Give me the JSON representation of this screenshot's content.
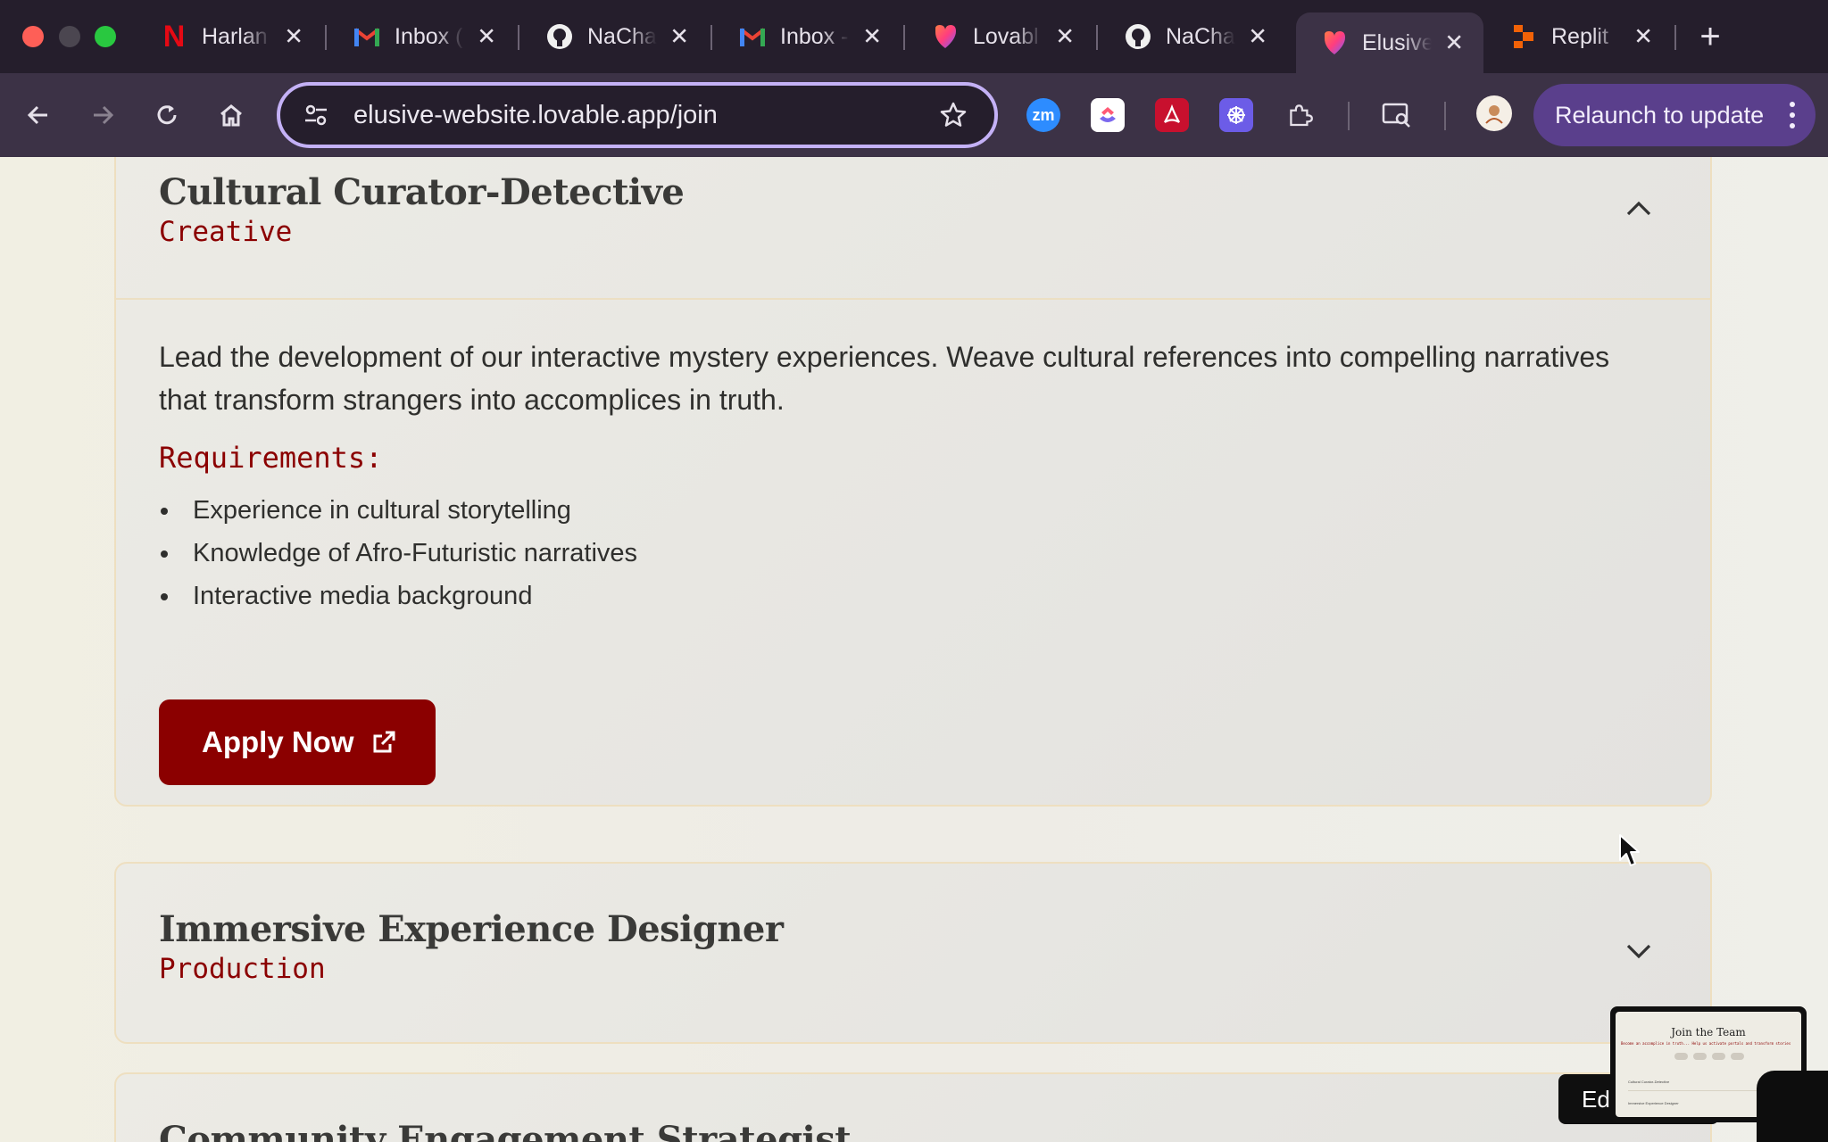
{
  "browser": {
    "tabs": [
      {
        "title": "Harlan",
        "icon": "netflix-icon"
      },
      {
        "title": "Inbox (",
        "icon": "gmail-icon"
      },
      {
        "title": "NaCha",
        "icon": "github-icon"
      },
      {
        "title": "Inbox -",
        "icon": "gmail-icon"
      },
      {
        "title": "Lovabl",
        "icon": "lovable-icon"
      },
      {
        "title": "NaCha",
        "icon": "github-icon"
      },
      {
        "title": "Elusive",
        "icon": "lovable-icon",
        "active": true
      },
      {
        "title": "Replit",
        "icon": "replit-icon"
      }
    ],
    "url": "elusive-website.lovable.app/join",
    "relaunch_label": "Relaunch to update",
    "extensions": [
      "zoom-icon",
      "clickup-icon",
      "acrobat-icon",
      "perplexity-icon",
      "puzzle-icon"
    ],
    "colors": {
      "chrome_dark": "#251e2c",
      "toolbar": "#3c3246",
      "omnibox_border": "#c4b1f6",
      "relaunch_bg": "#5a3f8c"
    }
  },
  "page": {
    "roles": [
      {
        "title": "Cultural Curator-Detective",
        "category": "Creative",
        "expanded": true,
        "description": "Lead the development of our interactive mystery experiences. Weave cultural references into compelling narratives that transform strangers into accomplices in truth.",
        "requirements_heading": "Requirements:",
        "requirements": [
          "Experience in cultural storytelling",
          "Knowledge of Afro-Futuristic narratives",
          "Interactive media background"
        ],
        "apply_label": "Apply Now"
      },
      {
        "title": "Immersive Experience Designer",
        "category": "Production",
        "expanded": false
      },
      {
        "title": "Community Engagement Strategist",
        "expanded": false
      }
    ],
    "colors": {
      "accent": "#8b0000",
      "card_border": "#eedfc0"
    }
  },
  "overlay": {
    "edit_label": "Edi",
    "preview_title": "Join the Team",
    "preview_subtitle": "Become an accomplice in truth... Help us activate portals and transform stories",
    "preview_row1": "Cultural Curator-Detective",
    "preview_row2": "Immersive Experience Designer"
  }
}
